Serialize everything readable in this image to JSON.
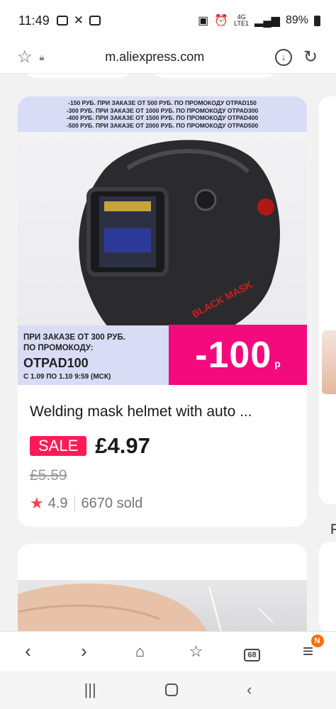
{
  "status": {
    "time": "11:49",
    "network": "4G",
    "carrier": "LTE1",
    "battery": "89%"
  },
  "browser": {
    "url": "m.aliexpress.com"
  },
  "product": {
    "banner_lines": [
      "-150 РУБ. ПРИ ЗАКАЗЕ ОТ 500 РУБ. ПО ПРОМОКОДУ OTPAD150",
      "-300 РУБ. ПРИ ЗАКАЗЕ ОТ 1000 РУБ. ПО ПРОМОКОДУ OTPAD300",
      "-400 РУБ. ПРИ ЗАКАЗЕ ОТ 1500 РУБ. ПО ПРОМОКОДУ OTPAD400",
      "-500 РУБ. ПРИ ЗАКАЗЕ ОТ 2000 РУБ. ПО ПРОМОКОДУ OTPAD500"
    ],
    "promo_condition_1": "ПРИ ЗАКАЗЕ ОТ 300 РУБ.",
    "promo_condition_2": "ПО ПРОМОКОДУ:",
    "promo_code": "OTPAD100",
    "promo_dates": "С 1.09 ПО 1.10 9:59 (МСК)",
    "discount_value": "-100",
    "discount_currency": "р",
    "brand_mark": "BLACK MASK",
    "title": "Welding mask helmet with auto ...",
    "sale_label": "SALE",
    "price": "£4.97",
    "old_price": "£5.59",
    "rating": "4.9",
    "sold": "6670 sold"
  },
  "nav": {
    "tabs_count": "68",
    "notification": "N"
  },
  "colors": {
    "accent_pink": "#f30a7d",
    "sale_red": "#ff1a55",
    "promo_blue": "#d8dcf5",
    "notif_orange": "#f5700a"
  }
}
